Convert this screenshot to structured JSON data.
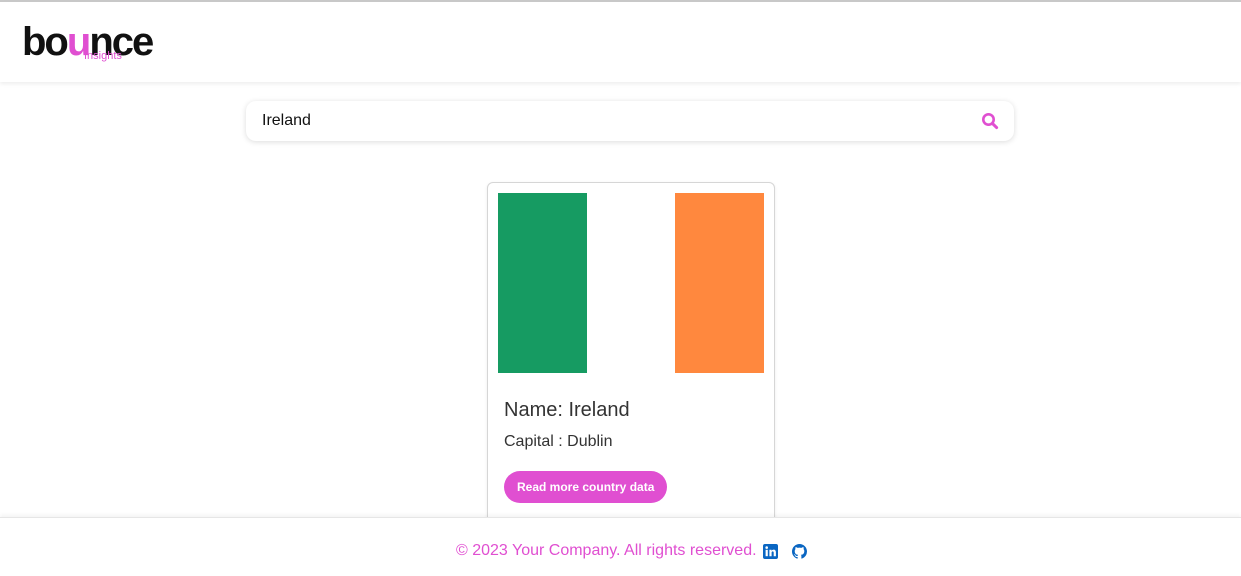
{
  "header": {
    "logo": {
      "word_start": "bo",
      "word_accent": "u",
      "word_end": "nce",
      "subtitle": "Insights"
    }
  },
  "search": {
    "value": "Ireland",
    "icon": "search-icon"
  },
  "country_card": {
    "name_text": "Name: Ireland",
    "capital_text": "Capital : Dublin",
    "button_label": "Read more country data",
    "flag_colors": [
      "#169b62",
      "#ffffff",
      "#ff883e"
    ]
  },
  "footer": {
    "copyright": "© 2023 Your Company. All rights reserved.",
    "links": [
      {
        "icon": "linkedin-icon"
      },
      {
        "icon": "github-icon"
      }
    ]
  },
  "colors": {
    "accent": "#e04fd1",
    "social_icon": "#0a66c2",
    "text": "#333333"
  }
}
